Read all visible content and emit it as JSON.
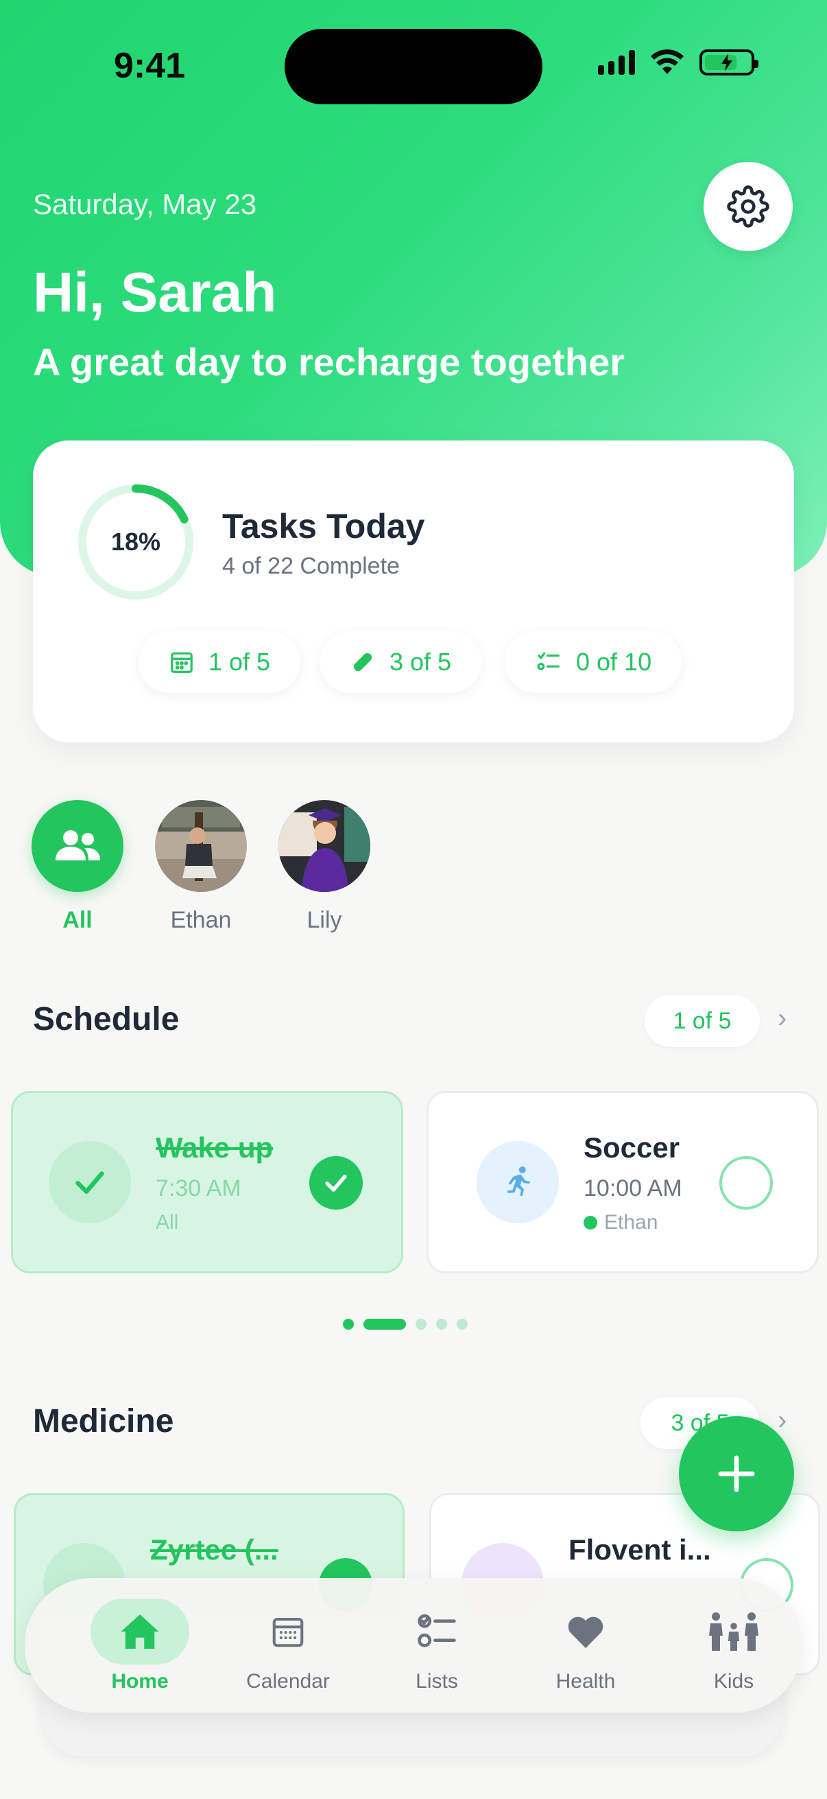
{
  "status": {
    "time": "9:41"
  },
  "header": {
    "date": "Saturday, May 23",
    "greeting": "Hi, Sarah",
    "tagline": "A great day to recharge together"
  },
  "tasks_card": {
    "progress": 18,
    "progress_label": "18%",
    "title": "Tasks Today",
    "subtitle": "4 of 22 Complete",
    "pills": [
      {
        "icon": "calendar-icon",
        "label": "1 of 5"
      },
      {
        "icon": "pill-icon",
        "label": "3 of 5"
      },
      {
        "icon": "checklist-icon",
        "label": "0 of 10"
      }
    ]
  },
  "members": [
    {
      "name": "All",
      "icon": "people-icon",
      "active": true
    },
    {
      "name": "Ethan",
      "icon": "avatar-photo",
      "active": false
    },
    {
      "name": "Lily",
      "icon": "avatar-photo",
      "active": false
    }
  ],
  "schedule": {
    "title": "Schedule",
    "count": "1 of 5",
    "items": [
      {
        "name": "Wake up",
        "time": "7:30 AM",
        "who": "All",
        "done": true,
        "icon": "check-icon"
      },
      {
        "name": "Soccer",
        "time": "10:00 AM",
        "who": "Ethan",
        "done": false,
        "icon": "runner-icon"
      }
    ]
  },
  "medicine": {
    "title": "Medicine",
    "count": "3 of 5",
    "items": [
      {
        "name": "Zyrtec (...",
        "done": true
      },
      {
        "name": "Flovent i...",
        "done": false
      }
    ]
  },
  "tabs": [
    {
      "label": "Home",
      "icon": "home-icon",
      "active": true
    },
    {
      "label": "Calendar",
      "icon": "calendar-icon",
      "active": false
    },
    {
      "label": "Lists",
      "icon": "list-icon",
      "active": false
    },
    {
      "label": "Health",
      "icon": "heart-icon",
      "active": false
    },
    {
      "label": "Kids",
      "icon": "family-icon",
      "active": false
    }
  ],
  "colors": {
    "accent": "#22c55e",
    "accent_light": "#d8f5e3"
  }
}
